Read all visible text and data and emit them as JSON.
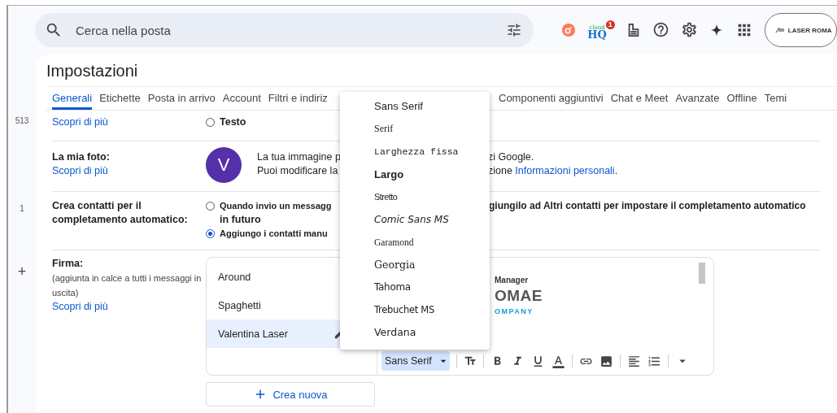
{
  "search": {
    "placeholder": "Cerca nella posta"
  },
  "apps": {
    "cloudhq_logo": [
      "cloud",
      "HQ"
    ],
    "cloudhq_badge": "1",
    "account_logo": "LASER ROMA"
  },
  "rail": [
    "513",
    "1",
    "+"
  ],
  "title": "Impostazioni",
  "tabs": [
    {
      "label": "Generali",
      "selected": true
    },
    {
      "label": "Etichette",
      "selected": false
    },
    {
      "label": "Posta in arrivo",
      "selected": false
    },
    {
      "label": "Account",
      "selected": false
    },
    {
      "label": "Filtri e indiriz",
      "selected": false
    }
  ],
  "more_tabs": [
    {
      "label": "Componenti aggiuntivi",
      "selected": false
    },
    {
      "label": "Chat e Meet",
      "selected": false
    },
    {
      "label": "Avanzate",
      "selected": false
    },
    {
      "label": "Offline",
      "selected": false
    },
    {
      "label": "Temi",
      "selected": false
    }
  ],
  "display_row": {
    "link": "Scopri di più",
    "options": [
      {
        "label": "Testo",
        "selected": false
      }
    ]
  },
  "photo_row": {
    "label": "La mia foto:",
    "link": "Scopri di più",
    "avatar": "V",
    "lines": [
      {
        "before": "La tua immagine p",
        "after": "zi Google."
      },
      {
        "before": "Puoi modificare la",
        "after": "zione ",
        "link": "Informazioni personali",
        "end": "."
      }
    ]
  },
  "contacts_row": {
    "label": "Crea contatti per il completamento automatico:",
    "options": [
      {
        "selected": false,
        "before": "Quando invio un messagg",
        "after": "giungilo ad Altri contatti per impostare il completamento automatico",
        "more": "in futuro"
      },
      {
        "selected": true,
        "before": "Aggiungo i contatti manu"
      }
    ]
  },
  "signature_row": {
    "label": "Firma:",
    "hint": "(aggiunta in calce a tutti i messaggi in uscita)",
    "link": "Scopri di più",
    "signatures": [
      {
        "name": "Around",
        "selected": false
      },
      {
        "name": "Spaghetti",
        "selected": false
      },
      {
        "name": "Valentina Laser",
        "selected": true
      }
    ],
    "preview": {
      "role": "Manager",
      "logo_main": "OMAE",
      "logo_sub": "OMPANY"
    },
    "font": "Sans Serif",
    "create_button": "Crea nuova"
  },
  "font_menu": [
    {
      "label": "Sans Serif",
      "kind": "sans"
    },
    {
      "label": "Serif",
      "kind": "serif"
    },
    {
      "label": "Larghezza fissa",
      "kind": "mono"
    },
    {
      "label": "Largo",
      "kind": "wide"
    },
    {
      "label": "Stretto",
      "kind": "narrow"
    },
    {
      "label": "Comic Sans MS",
      "kind": "comic"
    },
    {
      "label": "Garamond",
      "kind": "garamond"
    },
    {
      "label": "Georgia",
      "kind": "georgia"
    },
    {
      "label": "Tahoma",
      "kind": "tahoma"
    },
    {
      "label": "Trebuchet MS",
      "kind": "trebuchet"
    },
    {
      "label": "Verdana",
      "kind": "verdana"
    }
  ]
}
